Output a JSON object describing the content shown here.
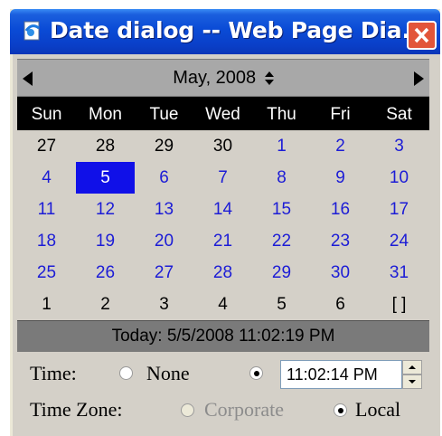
{
  "window": {
    "title": "Date dialog -- Web Page Dia...",
    "close_icon": "close-x-icon",
    "title_icon": "ie-page-icon",
    "titlebar_color": "#0a4bd6",
    "close_color": "#e2553a"
  },
  "calendar": {
    "month_label": "May, 2008",
    "month_arrows": "▲▼",
    "prev_icon": "triangle-left-icon",
    "next_icon": "triangle-right-icon",
    "day_names": [
      "Sun",
      "Mon",
      "Tue",
      "Wed",
      "Thu",
      "Fri",
      "Sat"
    ],
    "weeks": [
      [
        "27",
        "28",
        "29",
        "30",
        "1",
        "2",
        "3"
      ],
      [
        "4",
        "5",
        "6",
        "7",
        "8",
        "9",
        "10"
      ],
      [
        "11",
        "12",
        "13",
        "14",
        "15",
        "16",
        "17"
      ],
      [
        "18",
        "19",
        "20",
        "21",
        "22",
        "23",
        "24"
      ],
      [
        "25",
        "26",
        "27",
        "28",
        "29",
        "30",
        "31"
      ],
      [
        "1",
        "2",
        "3",
        "4",
        "5",
        "6",
        "[ ]"
      ]
    ],
    "selected_day": "5",
    "current_month_color": "#1c1cd6",
    "selected_bg": "#1010e8",
    "today_label": "Today: 5/5/2008 11:02:19 PM"
  },
  "time": {
    "label": "Time:",
    "none_label": "None",
    "none_checked": false,
    "value_checked": true,
    "value": "11:02:14 PM"
  },
  "timezone": {
    "label": "Time Zone:",
    "corporate_label": "Corporate",
    "corporate_enabled": false,
    "local_label": "Local",
    "local_checked": true
  }
}
